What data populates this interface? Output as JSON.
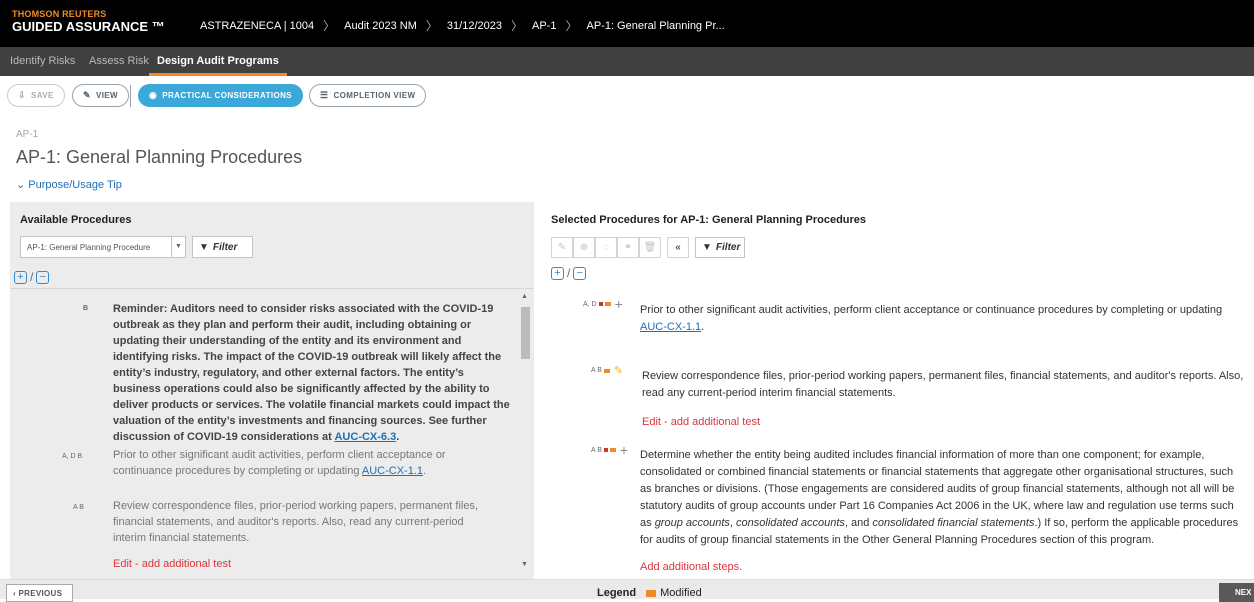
{
  "brand": {
    "company": "THOMSON REUTERS",
    "product": "GUIDED ASSURANCE ™"
  },
  "breadcrumb": [
    "ASTRAZENECA | 1004",
    "Audit 2023 NM",
    "31/12/2023",
    "AP-1",
    "AP-1: General Planning Pr..."
  ],
  "tabs": [
    {
      "label": "Identify Risks"
    },
    {
      "label": "Assess Risk"
    },
    {
      "label": "Design Audit Programs",
      "active": true
    }
  ],
  "toolbar": {
    "save": "SAVE",
    "view": "VIEW",
    "practical": "PRACTICAL CONSIDERATIONS",
    "completion": "COMPLETION VIEW"
  },
  "page": {
    "code": "AP-1",
    "title": "AP-1: General Planning Procedures",
    "purpose": "Purpose/Usage Tip"
  },
  "left": {
    "heading": "Available Procedures",
    "dropdown_value": "AP-1: General Planning Procedure",
    "filter": "Filter",
    "items": [
      {
        "tags": "B",
        "text": "Reminder: Auditors need to consider risks associated with the COVID-19 outbreak as they plan and perform their audit, including obtaining or updating their understanding of the entity and its environment and identifying risks. The impact of the COVID-19 outbreak will likely affect the entity’s industry, regulatory, and other external factors. The entity’s business operations could also be significantly affected by the ability to deliver products or services. The volatile financial markets could impact the valuation of the entity’s investments and financing sources. See further discussion of COVID-19 considerations at",
        "link": "AUC-CX-6.3",
        "suffix": "."
      },
      {
        "tags": "A, D B",
        "text": "Prior to other significant audit activities, perform client acceptance or continuance procedures by completing or updating",
        "link": "AUC-CX-1.1",
        "suffix": "."
      },
      {
        "tags": "A B",
        "text": "Review correspondence files, prior-period working papers, permanent files, financial statements, and auditor's reports. Also, read any current-period interim financial statements.",
        "action": "Edit - add additional test"
      }
    ]
  },
  "right": {
    "heading": "Selected Procedures for AP-1: General Planning Procedures",
    "filter": "Filter",
    "items": [
      {
        "tags": "A, D",
        "text": "Prior to other significant audit activities, perform client acceptance or continuance procedures by completing or updating",
        "link": "AUC-CX-1.1",
        "suffix": "."
      },
      {
        "tags": "A B",
        "text": "Review correspondence files, prior-period working papers, permanent files, financial statements, and auditor's reports. Also, read any current-period interim financial statements.",
        "action": "Edit - add additional test"
      },
      {
        "tags": "A B",
        "text_a": "Determine whether the entity being audited includes financial information of more than one component; for example, consolidated or combined financial statements or financial statements that aggregate other organisational structures, such as branches or divisions. (Those engagements are considered audits of group financial statements, although not all will be statutory audits of group accounts under Part 16 Companies Act 2006 in the UK, where law and regulation use terms such as",
        "em1": "group accounts",
        "sep1": ",",
        "em2": "consolidated accounts",
        "sep2": ", and",
        "em3": "consolidated financial statements",
        "text_b": ".) If so, perform the applicable procedures for audits of group financial statements in the Other General Planning Procedures section of this program.",
        "action": "Add additional steps."
      }
    ]
  },
  "footer": {
    "previous": "PREVIOUS",
    "legend_title": "Legend",
    "legend_item": "Modified",
    "next": "NEX"
  },
  "colors": {
    "accent": "#f08a24",
    "primary": "#3aa8d8",
    "link": "#1f6fb4",
    "danger": "#d9363e"
  }
}
